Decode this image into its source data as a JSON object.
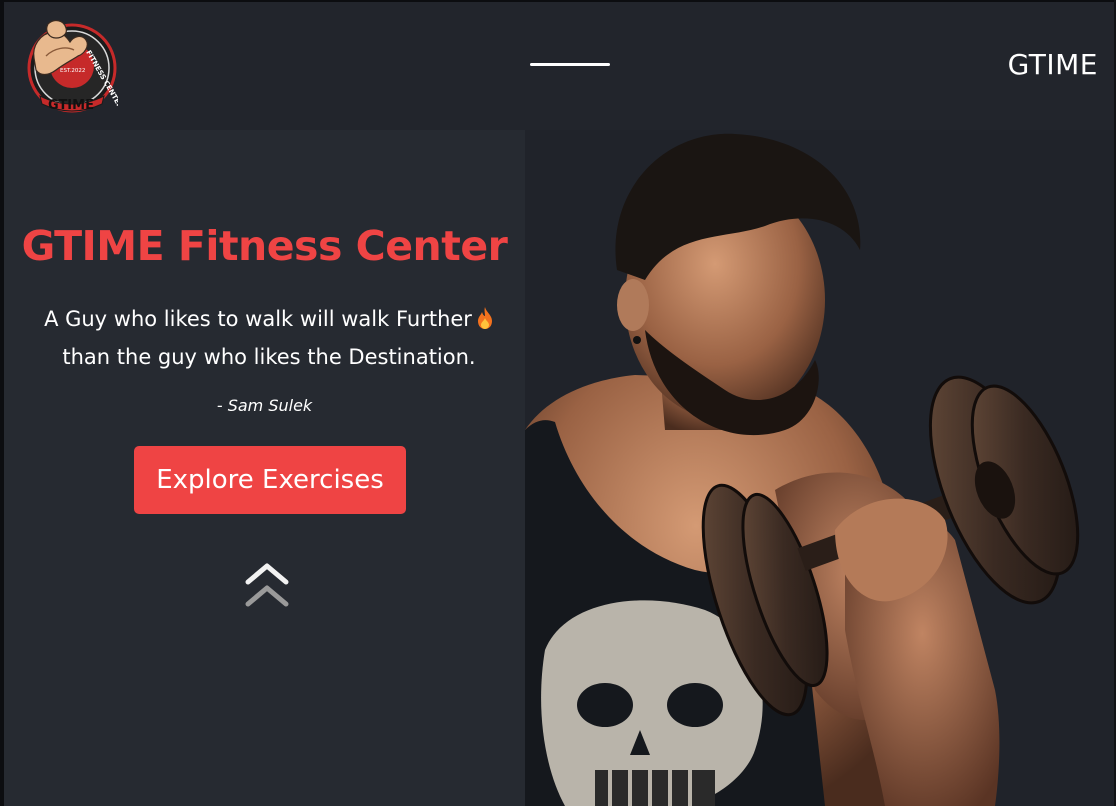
{
  "navbar": {
    "logo": {
      "top_text": "FITNESS CENTER",
      "est_text": "EST.2022",
      "bottom_text": "GTIME"
    },
    "menu_icon": "hamburger-menu-icon",
    "brand": "GTIME"
  },
  "hero": {
    "title": "GTIME Fitness Center",
    "quote_line_1": "A Guy who likes to walk will walk Further",
    "quote_line_2": "than the guy who likes the Destination.",
    "author": "- Sam Sulek",
    "cta_label": "Explore Exercises",
    "scroll_icon": "double-chevron-up-icon",
    "image": "man-lifting-dumbbell-photo"
  },
  "colors": {
    "background": "#262a31",
    "navbar": "#22252c",
    "accent": "#ef4444",
    "text": "#ffffff"
  }
}
